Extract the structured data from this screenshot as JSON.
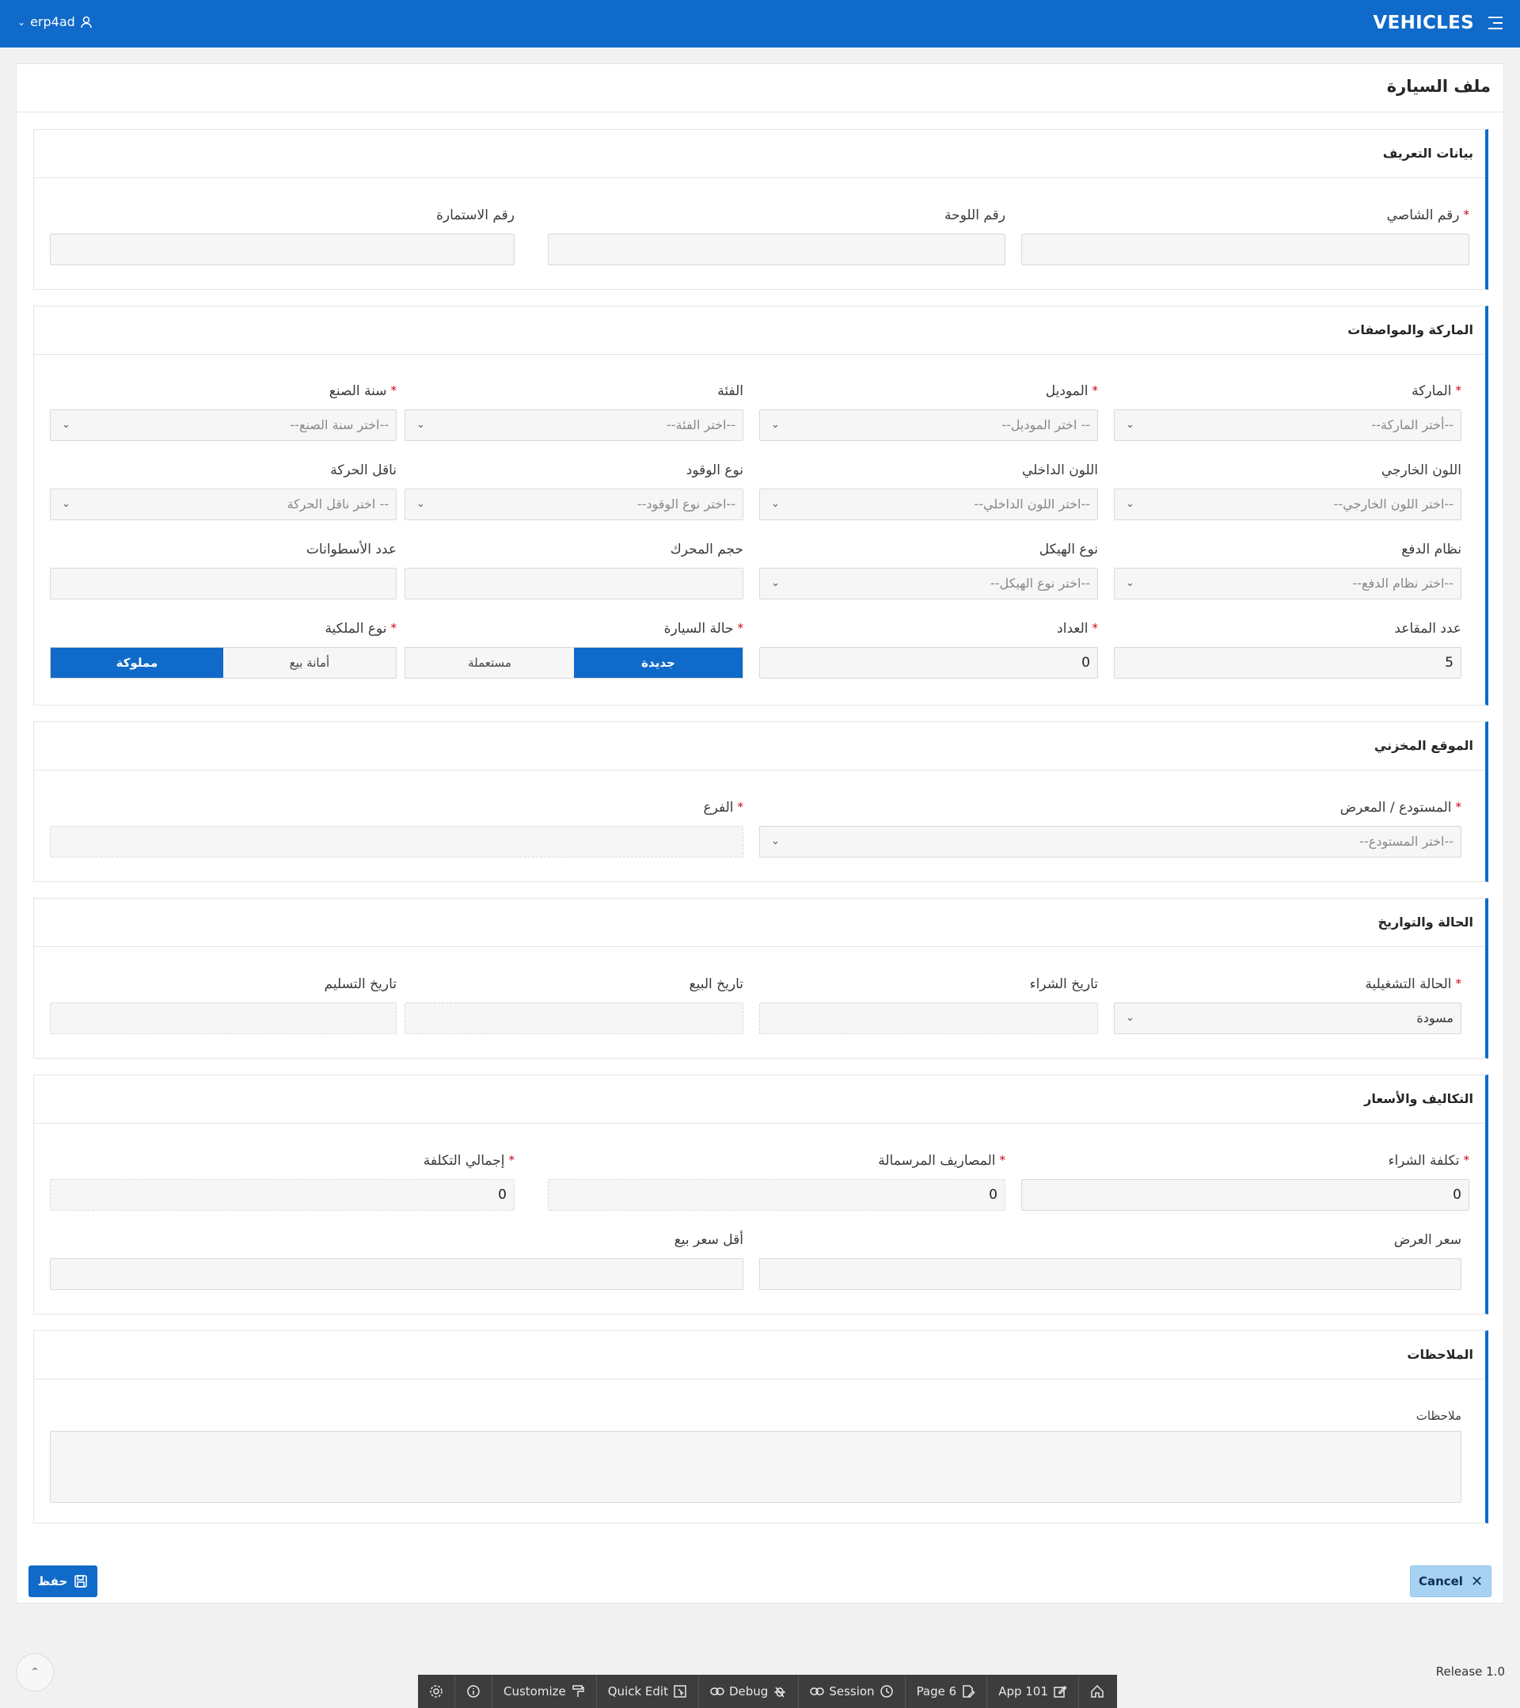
{
  "topbar": {
    "user": "erp4ad",
    "app_title": "VEHICLES"
  },
  "page_title": "ملف السيارة",
  "sections": {
    "identity": {
      "title": "بيانات التعريف",
      "chassis_label": "رقم الشاصي",
      "plate_label": "رقم اللوحة",
      "form_label": "رقم الاستمارة"
    },
    "specs": {
      "title": "الماركة والمواصفات",
      "brand_label": "الماركة",
      "brand_ph": "--أختر الماركة--",
      "model_label": "الموديل",
      "model_ph": "-- اختر الموديل--",
      "category_label": "الفئة",
      "category_ph": "--اختر الفئة--",
      "year_label": "سنة الصنع",
      "year_ph": "--اختر سنة الصنع--",
      "ext_color_label": "اللون الخارجي",
      "ext_color_ph": "--اختر اللون الخارجي--",
      "int_color_label": "اللون الداخلي",
      "int_color_ph": "--اختر اللون الداخلي--",
      "fuel_label": "نوع الوقود",
      "fuel_ph": "--اختر نوع الوقود--",
      "trans_label": "ناقل الحركة",
      "trans_ph": "-- اختر ناقل الحركة",
      "drive_label": "نظام الدفع",
      "drive_ph": "--اختر نظام الدفع--",
      "body_label": "نوع الهيكل",
      "body_ph": "--اختر نوع الهيكل--",
      "engine_label": "حجم المحرك",
      "cylinders_label": "عدد الأسطوانات",
      "seats_label": "عدد المقاعد",
      "seats_value": "5",
      "odometer_label": "العداد",
      "odometer_value": "0",
      "condition_label": "حالة السيارة",
      "condition_new": "جديدة",
      "condition_used": "مستعملة",
      "ownership_label": "نوع الملكية",
      "ownership_consign": "أمانة بيع",
      "ownership_owned": "مملوكة"
    },
    "location": {
      "title": "الموقع المخزني",
      "warehouse_label": "المستودع / المعرض",
      "warehouse_ph": "--اختر المستودع--",
      "branch_label": "الفرع"
    },
    "status": {
      "title": "الحالة والتواريخ",
      "op_status_label": "الحالة التشغيلية",
      "op_status_value": "مسودة",
      "purchase_date_label": "تاريخ الشراء",
      "sale_date_label": "تاريخ البيع",
      "delivery_date_label": "تاريخ التسليم"
    },
    "costs": {
      "title": "التكاليف والأسعار",
      "purchase_cost_label": "تكلفة الشراء",
      "purchase_cost_value": "0",
      "capitalized_label": "المصاريف المرسمالة",
      "capitalized_value": "0",
      "total_cost_label": "إجمالي التكلفة",
      "total_cost_value": "0",
      "offer_price_label": "سعر العرض",
      "min_price_label": "أقل سعر بيع"
    },
    "notes": {
      "title": "الملاحظات",
      "notes_label": "ملاحظات"
    }
  },
  "buttons": {
    "save": "حفظ",
    "cancel": "Cancel"
  },
  "footer": {
    "release": "Release 1.0"
  },
  "devbar": {
    "customize": "Customize",
    "quick_edit": "Quick Edit",
    "debug": "Debug",
    "session": "Session",
    "page": "Page 6",
    "app": "App 101"
  },
  "colors": {
    "primary": "#0f6ac9",
    "required": "#d0021b"
  }
}
